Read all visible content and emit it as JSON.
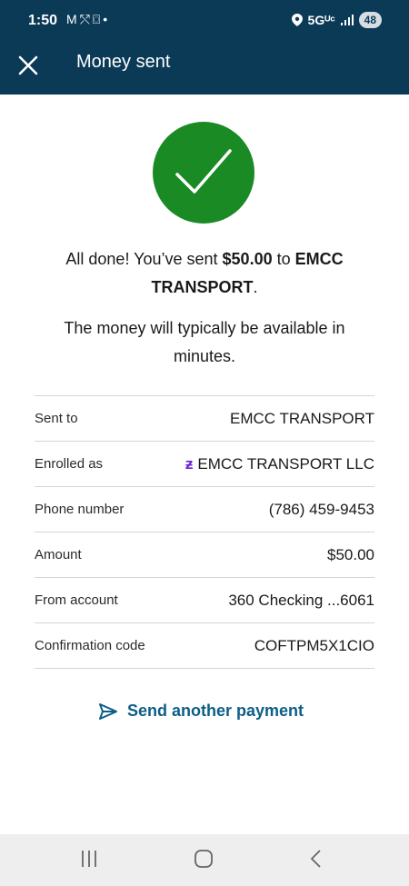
{
  "status_bar": {
    "time": "1:50",
    "network": "5Gᵁᶜ",
    "battery": "48",
    "icons": [
      "gmail-icon",
      "missed-call-icon",
      "screenshot-icon",
      "dot-icon",
      "location-icon",
      "signal-icon"
    ]
  },
  "app_bar": {
    "title": "Money sent"
  },
  "confirmation": {
    "prefix": "All done! You’ve sent ",
    "amount": "$50.00",
    "to_word": " to ",
    "recipient": "EMCC TRANSPORT",
    "period": ".",
    "availability": "The money will typically be available in minutes."
  },
  "details": [
    {
      "label": "Sent to",
      "value": "EMCC TRANSPORT"
    },
    {
      "label": "Enrolled as",
      "value": "EMCC TRANSPORT LLC"
    },
    {
      "label": "Phone number",
      "value": "(786) 459-9453"
    },
    {
      "label": "Amount",
      "value": "$50.00"
    },
    {
      "label": "From account",
      "value": "360 Checking ...6061"
    },
    {
      "label": "Confirmation code",
      "value": "COFTPM5X1CIO"
    }
  ],
  "actions": {
    "send_another": "Send another payment"
  },
  "colors": {
    "header_bg": "#0b3a57",
    "success_green": "#1a8a25",
    "link_blue": "#0c5e86",
    "zelle_purple": "#6d1ed4"
  }
}
